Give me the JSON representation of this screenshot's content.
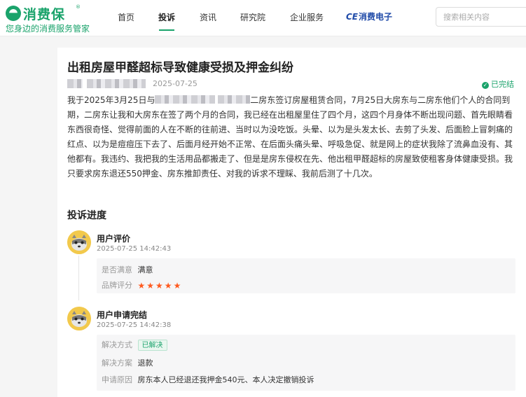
{
  "brand": {
    "name": "消费保",
    "registered": "®",
    "slogan": "您身边的消费服务管家",
    "color": "#1aa36b"
  },
  "nav": {
    "items": [
      "首页",
      "投诉",
      "资讯",
      "研究院",
      "企业服务"
    ],
    "active": "投诉",
    "ce_mark": "CE",
    "ce_label": "消费电子"
  },
  "search": {
    "placeholder": "搜索相关内容"
  },
  "complaint": {
    "title": "出租房屋甲醛超标导致健康受损及押金纠纷",
    "date": "2025-07-25",
    "status": "已完结",
    "status_icon": "check-circle-icon",
    "body_prefix": "我于2025年3月25日与",
    "body_rest": "二房东签订房屋租赁合同，7月25日大房东与二房东他们个人的合同到期，二房东让我和大房东在签了两个月的合同，我已经在出租屋里住了四个月，这四个月身体不断出现问题、首先眼睛看东西很奇怪、觉得前面的人在不断的往前进、当时以为没吃饭。头晕、以为是头发太长、去剪了头发、后面脸上冒刺痛的红点、以为是痘痘压下去了、后面月经开始不正常、在后面头痛头晕、呼吸急促、就是网上的症状我除了流鼻血没有、其他都有。我违约、我把我的生活用品都搬走了、但是是房东侵权在先、他出租甲醛超标的房屋致使租客身体健康受损。我只要求房东退还550押金、房东推卸责任、对我的诉求不理睬、我前后测了十几次。"
  },
  "progress": {
    "title": "投诉进度",
    "steps": [
      {
        "name": "用户评价",
        "time": "2025-07-25 14:42:43",
        "rows": [
          {
            "label": "是否满意",
            "value": "满意"
          },
          {
            "label": "品牌评分",
            "stars": 5
          }
        ]
      },
      {
        "name": "用户申请完结",
        "time": "2025-07-25 14:42:38",
        "rows": [
          {
            "label": "解决方式",
            "tag": "已解决"
          },
          {
            "label": "解决方案",
            "value": "退款"
          },
          {
            "label": "申请原因",
            "value": "房东本人已经退还我押金540元、本人决定撤销投诉"
          }
        ]
      }
    ]
  },
  "colors": {
    "star": "#ff5a1f",
    "avatar_bg": "#f2c94c"
  }
}
